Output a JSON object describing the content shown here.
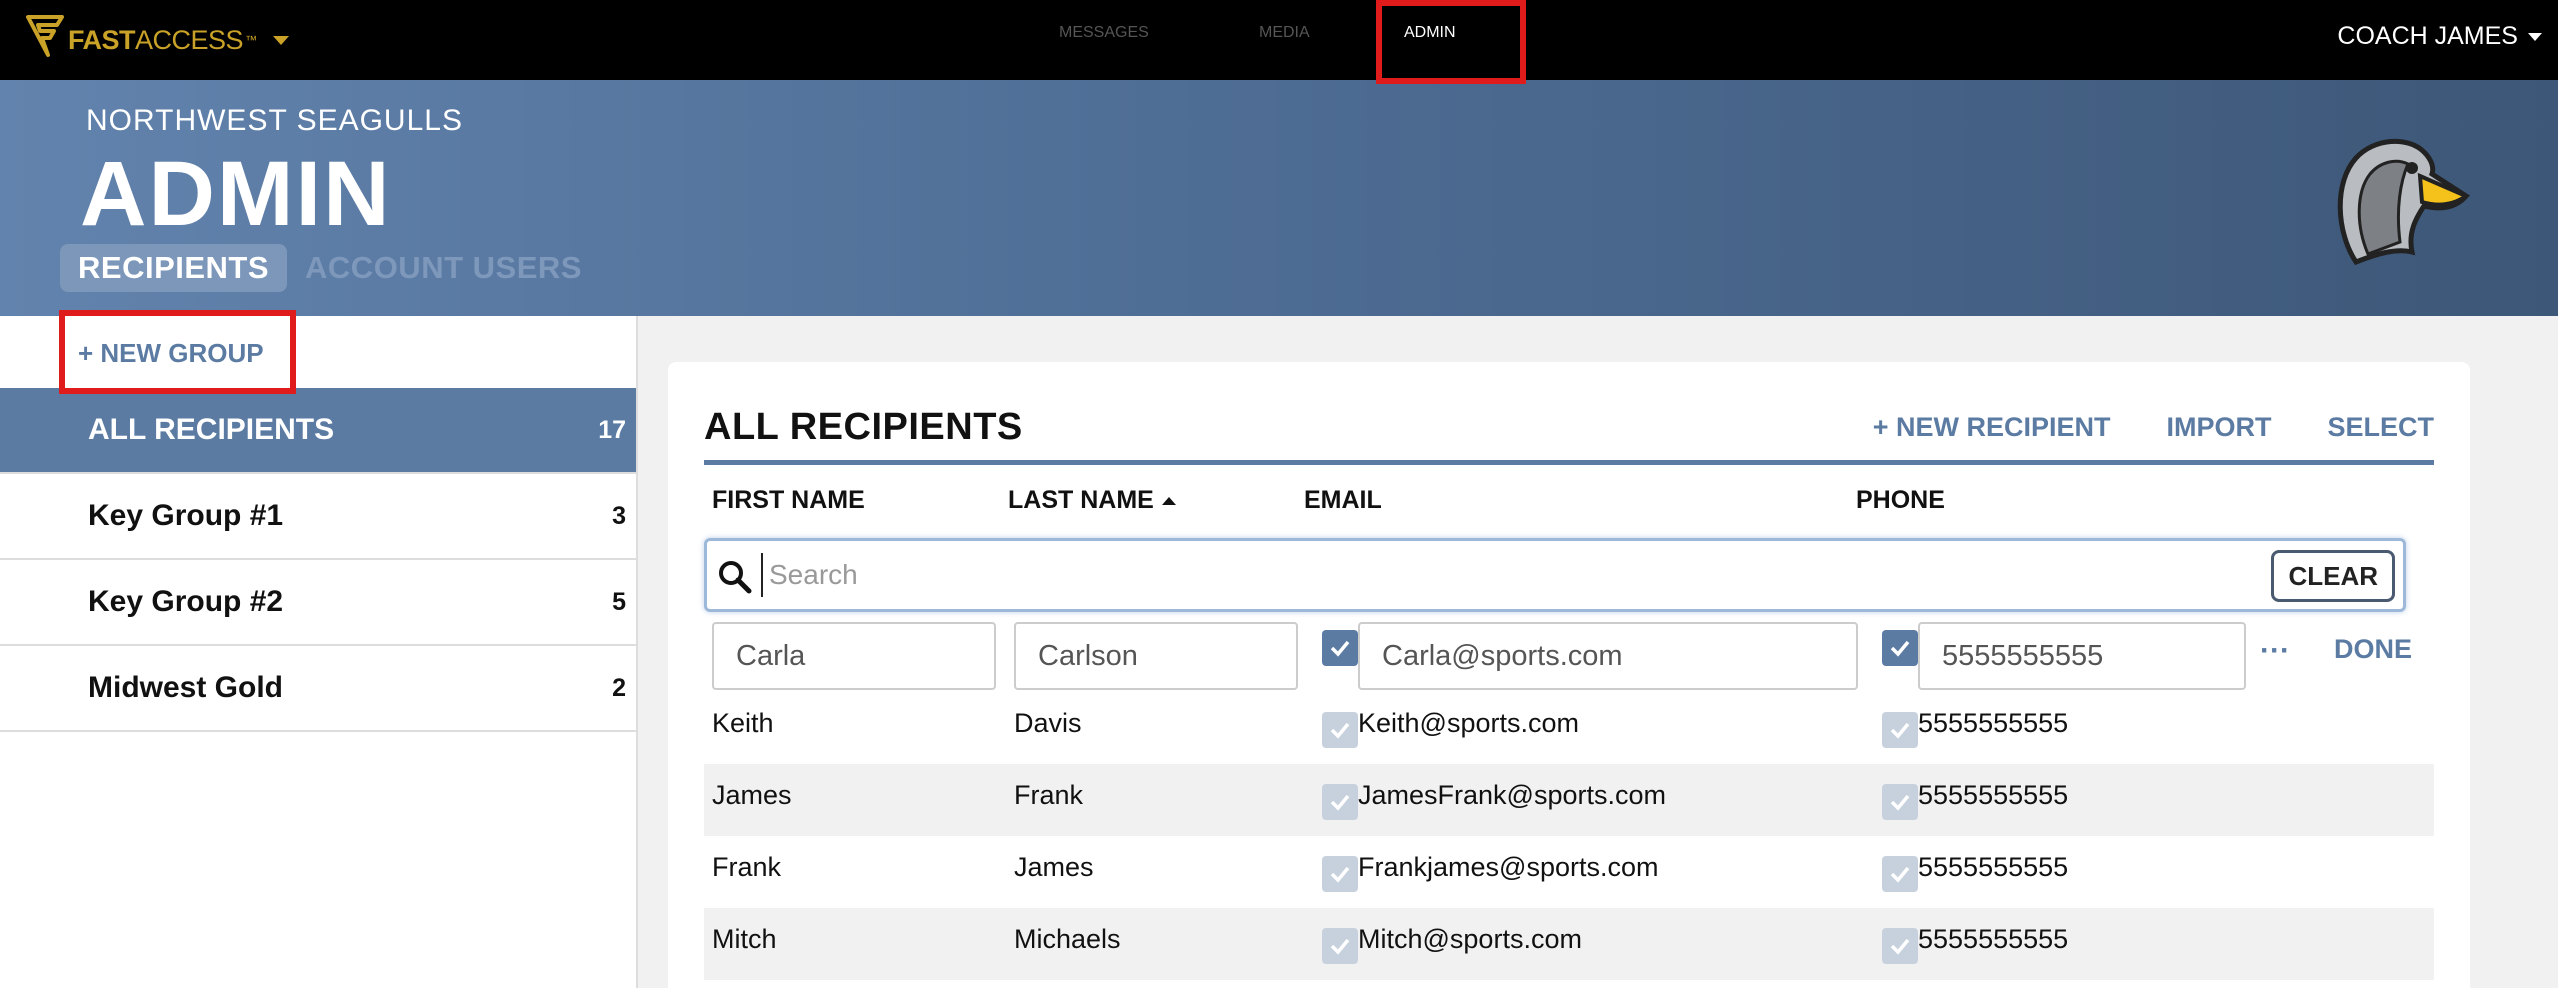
{
  "topbar": {
    "brand_bold": "FAST",
    "brand_rest": "ACCESS",
    "brand_tm": "™",
    "nav": [
      {
        "label": "MESSAGES"
      },
      {
        "label": "MEDIA"
      },
      {
        "label": "ADMIN",
        "active": true
      }
    ],
    "user": "COACH JAMES"
  },
  "header": {
    "team": "NORTHWEST SEAGULLS",
    "title": "ADMIN",
    "tabs": [
      {
        "label": "RECIPIENTS",
        "active": true
      },
      {
        "label": "ACCOUNT USERS"
      }
    ]
  },
  "sidebar": {
    "new_group": "+ NEW GROUP",
    "groups": [
      {
        "name": "ALL RECIPIENTS",
        "count": "17",
        "active": true
      },
      {
        "name": "Key Group #1",
        "count": "3"
      },
      {
        "name": "Key Group #2",
        "count": "5"
      },
      {
        "name": "Midwest Gold",
        "count": "2"
      }
    ]
  },
  "panel": {
    "title": "ALL RECIPIENTS",
    "actions": [
      "+ NEW RECIPIENT",
      "IMPORT",
      "SELECT"
    ],
    "columns": [
      "FIRST NAME",
      "LAST NAME",
      "EMAIL",
      "PHONE"
    ],
    "search_placeholder": "Search",
    "clear": "CLEAR",
    "edit_row": {
      "first": "Carla",
      "last": "Carlson",
      "email": "Carla@sports.com",
      "phone": "5555555555",
      "more": "···",
      "done": "DONE"
    },
    "rows": [
      {
        "first": "Keith",
        "last": "Davis",
        "email": "Keith@sports.com",
        "phone": "5555555555"
      },
      {
        "first": "James",
        "last": "Frank",
        "email": "JamesFrank@sports.com",
        "phone": "5555555555"
      },
      {
        "first": "Frank",
        "last": "James",
        "email": "Frankjames@sports.com",
        "phone": "5555555555"
      },
      {
        "first": "Mitch",
        "last": "Michaels",
        "email": "Mitch@sports.com",
        "phone": "5555555555"
      }
    ]
  },
  "colors": {
    "accent": "#5b7ba3",
    "highlight": "#e01b1b",
    "brand_gold": "#c9a227"
  },
  "icons": [
    "fastaccess-logo-icon",
    "seagull-mascot-icon",
    "search-icon",
    "checkbox-checked-icon"
  ]
}
